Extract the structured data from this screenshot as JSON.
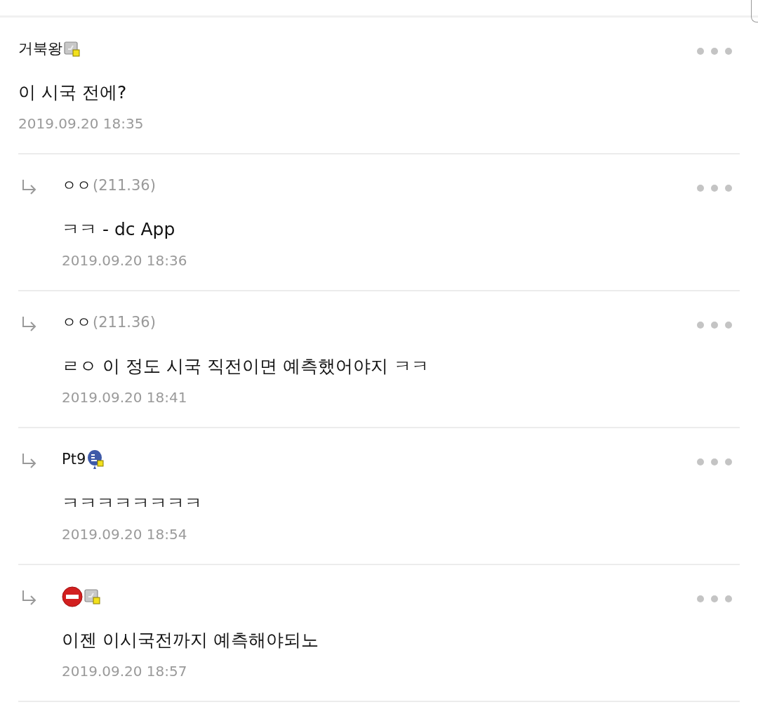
{
  "comments": [
    {
      "reply": false,
      "author": "거북왕",
      "badges": [
        {
          "kind": "gallery"
        }
      ],
      "text": "이 시국 전에?",
      "date": "2019.09.20 18:35"
    },
    {
      "reply": true,
      "author": "ㅇㅇ",
      "ip": "(211.36)",
      "text": "ㅋㅋ - dc App",
      "date": "2019.09.20 18:36"
    },
    {
      "reply": true,
      "author": "ㅇㅇ",
      "ip": "(211.36)",
      "text": "ㄹㅇ 이 정도 시국 직전이면 예측했어야지 ㅋㅋ",
      "date": "2019.09.20 18:41"
    },
    {
      "reply": true,
      "author": "Pt9",
      "badges": [
        {
          "kind": "app"
        }
      ],
      "text": "ㅋㅋㅋㅋㅋㅋㅋㅋ",
      "date": "2019.09.20 18:54"
    },
    {
      "reply": true,
      "badges": [
        {
          "kind": "blocked"
        },
        {
          "kind": "gallery"
        }
      ],
      "text": "이젠 이시국전까지 예측해야되노",
      "date": "2019.09.20 18:57"
    }
  ]
}
